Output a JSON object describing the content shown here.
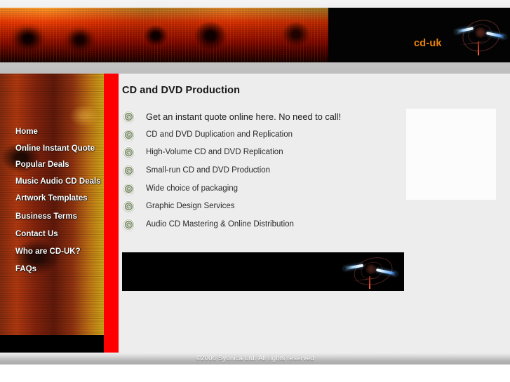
{
  "header": {
    "logo_text": "cd-uk",
    "logo_color": "#e8820c",
    "art_icon": "header-collage-art",
    "streak_icon": "light-streak-graphic"
  },
  "sidebar": {
    "items": [
      {
        "label": "Home"
      },
      {
        "label": "Online Instant Quote"
      },
      {
        "label": "Popular Deals"
      },
      {
        "label": "Music Audio CD Deals"
      },
      {
        "label": "Artwork Templates"
      },
      {
        "label": "Business Terms"
      },
      {
        "label": "Contact Us"
      },
      {
        "label": "Who are CD-UK?"
      },
      {
        "label": "FAQs"
      }
    ]
  },
  "divider": {
    "color": "#fe0000"
  },
  "main": {
    "title": "CD and DVD Production",
    "features": [
      {
        "text": "Get an instant quote online here. No need to call!",
        "icon": "cd-disc-icon"
      },
      {
        "text": "CD and DVD Duplication and Replication",
        "icon": "cd-disc-icon"
      },
      {
        "text": "High-Volume CD and DVD Replication",
        "icon": "cd-disc-icon"
      },
      {
        "text": "Small-run CD and DVD Production",
        "icon": "cd-disc-icon"
      },
      {
        "text": "Wide choice of packaging",
        "icon": "cd-disc-icon"
      },
      {
        "text": "Graphic Design Services",
        "icon": "cd-disc-icon"
      },
      {
        "text": "Audio CD Mastering & Online Distribution",
        "icon": "cd-disc-icon"
      }
    ],
    "image_placeholder": {
      "name": "product-image-placeholder"
    },
    "banner": {
      "name": "promo-black-banner",
      "icon": "light-streak-graphic"
    },
    "background_color": "#ededed"
  },
  "footer": {
    "copyright": "©2006 Syonica Ltd. All rights reserved"
  }
}
